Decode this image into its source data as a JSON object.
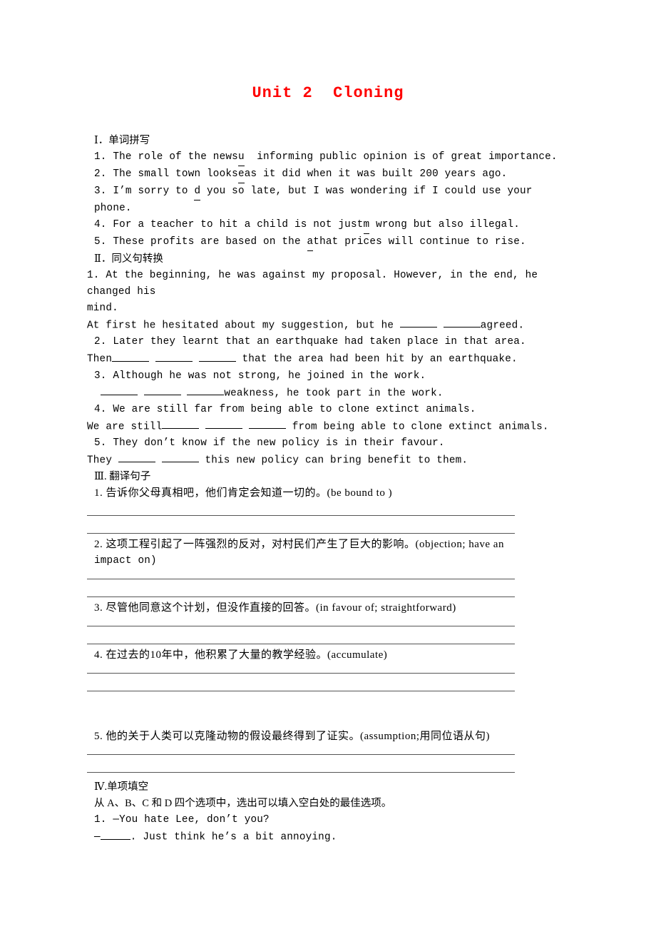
{
  "document": {
    "title": "Unit 2  Cloning",
    "title_color": "#ff0000"
  },
  "sections": {
    "s1": {
      "heading": "Ⅰ．单词拼写",
      "items": [
        {
          "pre": "1. The role of the news",
          "hint": "u",
          "post": "  informing public opinion is of great importance."
        },
        {
          "pre": "2. The small town looks",
          "hint": "e",
          "post": "as it did when it was built 200 years ago."
        },
        {
          "pre": "3. I’m sorry to ",
          "hint": "d",
          "post": " you so late, but I was wondering if I could use your phone."
        },
        {
          "pre": "4. For a teacher to hit a child is not just",
          "hint": "m",
          "post": " wrong but also illegal."
        },
        {
          "pre": "5. These profits are based on the ",
          "hint": "a",
          "post": "that prices will continue to rise."
        }
      ]
    },
    "s2": {
      "heading": "Ⅱ．同义句转换",
      "q1_a": "1. At the beginning, he was against my proposal. However, in the end, he changed his",
      "q1_b": "mind.",
      "q1_ans_pre": "At first he hesitated about my suggestion, but he ",
      "q1_ans_mid": " ",
      "q1_ans_post": "agreed.",
      "q2": "2. Later they learnt that an earthquake had taken place in that area.",
      "q2_ans_pre": "Then",
      "q2_ans_post": " that the area had been hit by an earthquake.",
      "q3": "3. Although he was not strong, he joined in the work.",
      "q3_ans_post": "weakness, he took part in the work.",
      "q4": "4. We are still far from being able to clone extinct animals.",
      "q4_ans_pre": "We are still",
      "q4_ans_post": " from being able to clone extinct animals.",
      "q5": "5. They don’t know if the new policy is in their favour.",
      "q5_ans_pre": "They ",
      "q5_ans_post": " this new policy can bring benefit to them."
    },
    "s3": {
      "heading": "Ⅲ. 翻译句子",
      "items": [
        {
          "text": "1. 告诉你父母真相吧，他们肯定会知道一切的。(be bound to )"
        },
        {
          "text": "2. 这项工程引起了一阵强烈的反对，对村民们产生了巨大的影响。(objection; have an",
          "cont": "impact on)"
        },
        {
          "text": "3. 尽管他同意这个计划，但没作直接的回答。(in favour of; straightforward)"
        },
        {
          "text": "4. 在过去的10年中，他积累了大量的教学经验。(accumulate)"
        },
        {
          "text": "5. 他的关于人类可以克隆动物的假设最终得到了证实。(assumption;用同位语从句)"
        }
      ]
    },
    "s4": {
      "heading": "Ⅳ.单项填空",
      "instruction": "从 A、B、C 和 D 四个选项中，选出可以填入空白处的最佳选项。",
      "q1_a": "1. —You hate Lee, don’t you?",
      "q1_b_pre": "—",
      "q1_b_post": ". Just think he’s a bit annoying."
    }
  }
}
